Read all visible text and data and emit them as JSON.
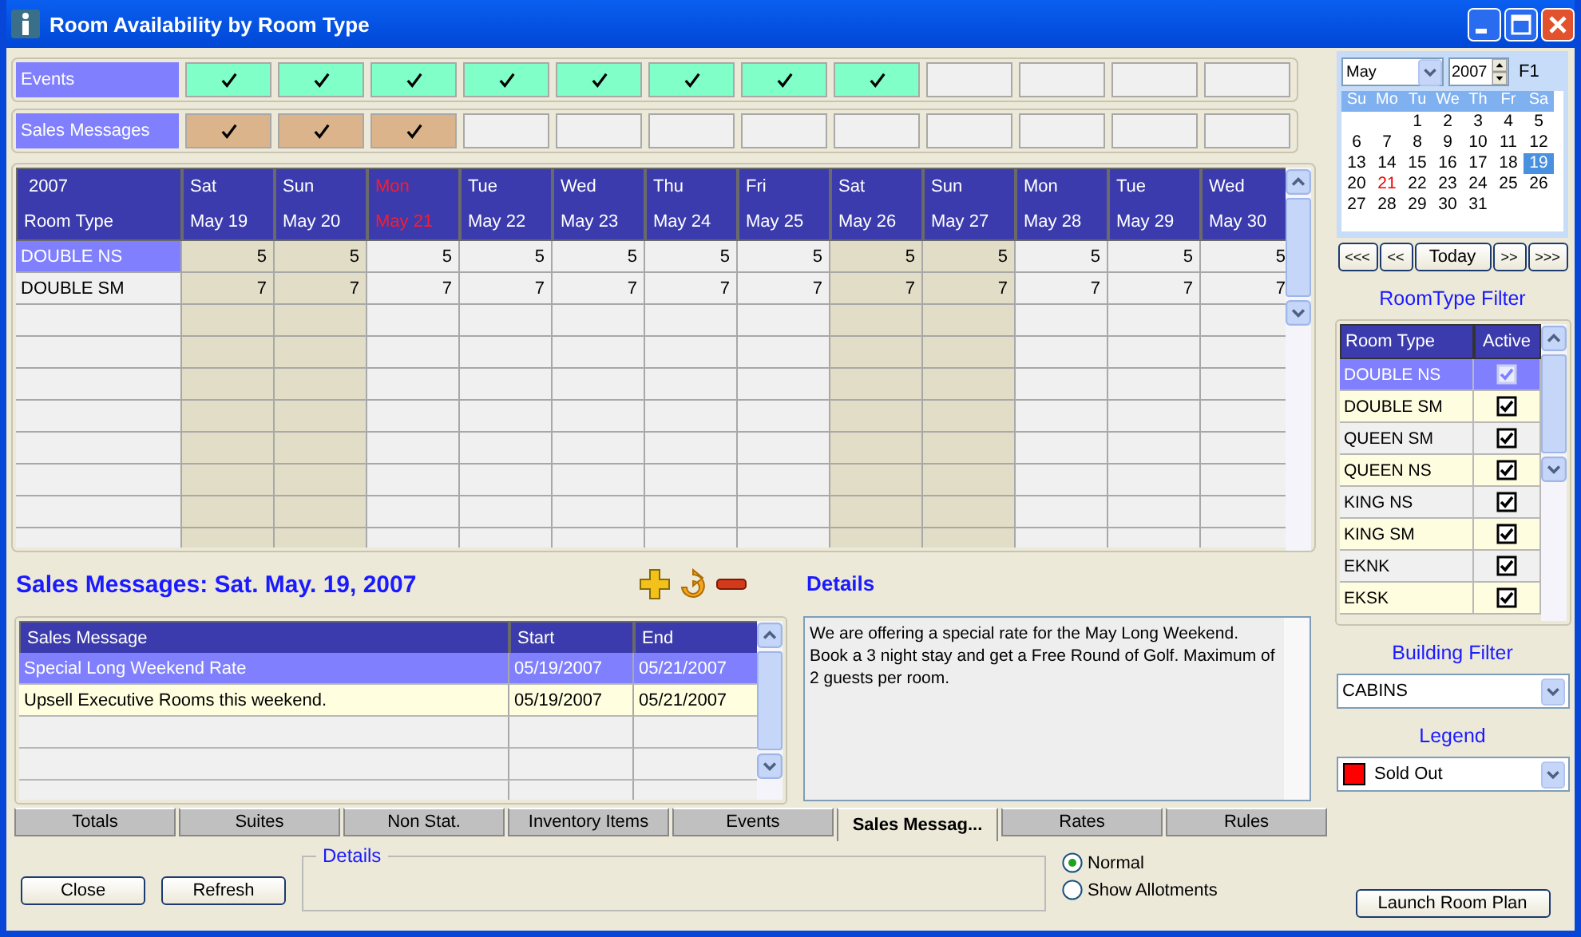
{
  "window": {
    "title": "Room Availability by Room Type"
  },
  "strips": [
    {
      "kind": "events",
      "label": "Events",
      "cells": [
        {
          "checked": true
        },
        {
          "checked": true
        },
        {
          "checked": true
        },
        {
          "checked": true
        },
        {
          "checked": true
        },
        {
          "checked": true
        },
        {
          "checked": true
        },
        {
          "checked": true
        },
        {
          "checked": false
        },
        {
          "checked": false
        },
        {
          "checked": false
        },
        {
          "checked": false
        }
      ]
    },
    {
      "kind": "sales",
      "label": "Sales Messages",
      "cells": [
        {
          "checked": true
        },
        {
          "checked": true
        },
        {
          "checked": true
        },
        {
          "checked": false
        },
        {
          "checked": false
        },
        {
          "checked": false
        },
        {
          "checked": false
        },
        {
          "checked": false
        },
        {
          "checked": false
        },
        {
          "checked": false
        },
        {
          "checked": false
        },
        {
          "checked": false
        }
      ]
    }
  ],
  "grid": {
    "year": "2007",
    "header": "Room Type",
    "days": [
      {
        "weekday": "Sat",
        "date": "May 19",
        "weekend": true,
        "holiday": false
      },
      {
        "weekday": "Sun",
        "date": "May 20",
        "weekend": true,
        "holiday": false
      },
      {
        "weekday": "Mon",
        "date": "May 21",
        "weekend": false,
        "holiday": true
      },
      {
        "weekday": "Tue",
        "date": "May 22",
        "weekend": false,
        "holiday": false
      },
      {
        "weekday": "Wed",
        "date": "May 23",
        "weekend": false,
        "holiday": false
      },
      {
        "weekday": "Thu",
        "date": "May 24",
        "weekend": false,
        "holiday": false
      },
      {
        "weekday": "Fri",
        "date": "May 25",
        "weekend": false,
        "holiday": false
      },
      {
        "weekday": "Sat",
        "date": "May 26",
        "weekend": true,
        "holiday": false
      },
      {
        "weekday": "Sun",
        "date": "May 27",
        "weekend": true,
        "holiday": false
      },
      {
        "weekday": "Mon",
        "date": "May 28",
        "weekend": false,
        "holiday": false
      },
      {
        "weekday": "Tue",
        "date": "May 29",
        "weekend": false,
        "holiday": false
      },
      {
        "weekday": "Wed",
        "date": "May 30",
        "weekend": false,
        "holiday": false
      }
    ],
    "rows": [
      {
        "name": "DOUBLE NS",
        "selected": true,
        "values": [
          "5",
          "5",
          "5",
          "5",
          "5",
          "5",
          "5",
          "5",
          "5",
          "5",
          "5",
          "5"
        ]
      },
      {
        "name": "DOUBLE SM",
        "selected": false,
        "values": [
          "7",
          "7",
          "7",
          "7",
          "7",
          "7",
          "7",
          "7",
          "7",
          "7",
          "7",
          "7"
        ]
      }
    ]
  },
  "sales_messages": {
    "title": "Sales Messages: Sat. May. 19, 2007",
    "columns": [
      "Sales Message",
      "Start",
      "End"
    ],
    "rows": [
      {
        "message": "Special Long Weekend Rate",
        "start": "05/19/2007",
        "end": "05/21/2007",
        "selected": true
      },
      {
        "message": "Upsell Executive Rooms this weekend.",
        "start": "05/19/2007",
        "end": "05/21/2007",
        "selected": false
      }
    ],
    "details_title": "Details",
    "details_text": "We are offering a special rate for the May Long Weekend. Book a 3 night stay and get a Free Round of Golf. Maximum of 2 guests per room."
  },
  "tabs": [
    {
      "label": "Totals",
      "selected": false
    },
    {
      "label": "Suites",
      "selected": false
    },
    {
      "label": "Non Stat.",
      "selected": false
    },
    {
      "label": "Inventory Items",
      "selected": false
    },
    {
      "label": "Events",
      "selected": false
    },
    {
      "label": "Sales Messag...",
      "selected": true
    },
    {
      "label": "Rates",
      "selected": false
    },
    {
      "label": "Rules",
      "selected": false
    }
  ],
  "buttons": [
    {
      "label": "Close"
    },
    {
      "label": "Refresh"
    }
  ],
  "details_group": {
    "legend": "Details"
  },
  "view_options": [
    {
      "label": "Normal",
      "selected": true
    },
    {
      "label": "Show Allotments",
      "selected": false
    }
  ],
  "calendar": {
    "month": "May",
    "year": "2007",
    "shortcut": "F1",
    "weekdays": [
      "Su",
      "Mo",
      "Tu",
      "We",
      "Th",
      "Fr",
      "Sa"
    ],
    "weeks": [
      {
        "days": [
          {
            "label": "1",
            "selected": false,
            "holiday": false
          },
          {
            "label": "2",
            "selected": false,
            "holiday": false
          },
          {
            "label": "3",
            "selected": false,
            "holiday": false
          },
          {
            "label": "4",
            "selected": false,
            "holiday": false
          },
          {
            "label": "5",
            "selected": false,
            "holiday": false
          }
        ]
      },
      {
        "days": [
          {
            "label": "6",
            "selected": false,
            "holiday": false
          },
          {
            "label": "7",
            "selected": false,
            "holiday": false
          },
          {
            "label": "8",
            "selected": false,
            "holiday": false
          },
          {
            "label": "9",
            "selected": false,
            "holiday": false
          },
          {
            "label": "10",
            "selected": false,
            "holiday": false
          },
          {
            "label": "11",
            "selected": false,
            "holiday": false
          },
          {
            "label": "12",
            "selected": false,
            "holiday": false
          }
        ]
      },
      {
        "days": [
          {
            "label": "13",
            "selected": false,
            "holiday": false
          },
          {
            "label": "14",
            "selected": false,
            "holiday": false
          },
          {
            "label": "15",
            "selected": false,
            "holiday": false
          },
          {
            "label": "16",
            "selected": false,
            "holiday": false
          },
          {
            "label": "17",
            "selected": false,
            "holiday": false
          },
          {
            "label": "18",
            "selected": false,
            "holiday": false
          },
          {
            "label": "19",
            "selected": true,
            "holiday": false
          }
        ]
      },
      {
        "days": [
          {
            "label": "20",
            "selected": false,
            "holiday": false
          },
          {
            "label": "21",
            "selected": false,
            "holiday": true
          },
          {
            "label": "22",
            "selected": false,
            "holiday": false
          },
          {
            "label": "23",
            "selected": false,
            "holiday": false
          },
          {
            "label": "24",
            "selected": false,
            "holiday": false
          },
          {
            "label": "25",
            "selected": false,
            "holiday": false
          },
          {
            "label": "26",
            "selected": false,
            "holiday": false
          }
        ]
      },
      {
        "days": [
          {
            "label": "27",
            "selected": false,
            "holiday": false
          },
          {
            "label": "28",
            "selected": false,
            "holiday": false
          },
          {
            "label": "29",
            "selected": false,
            "holiday": false
          },
          {
            "label": "30",
            "selected": false,
            "holiday": false
          },
          {
            "label": "31",
            "selected": false,
            "holiday": false
          }
        ]
      }
    ],
    "nav": [
      "<<<",
      "<<",
      "Today",
      ">>",
      ">>>"
    ]
  },
  "room_type_filter": {
    "title": "RoomType Filter",
    "columns": [
      "Room Type",
      "Active"
    ],
    "rows": [
      {
        "name": "DOUBLE NS",
        "active": true,
        "selected": true
      },
      {
        "name": "DOUBLE SM",
        "active": true,
        "selected": false
      },
      {
        "name": "QUEEN SM",
        "active": true,
        "selected": false
      },
      {
        "name": "QUEEN NS",
        "active": true,
        "selected": false
      },
      {
        "name": "KING NS",
        "active": true,
        "selected": false
      },
      {
        "name": "KING SM",
        "active": true,
        "selected": false
      },
      {
        "name": "EKNK",
        "active": true,
        "selected": false
      },
      {
        "name": "EKSK",
        "active": true,
        "selected": false
      }
    ]
  },
  "building_filter": {
    "title": "Building Filter",
    "value": "CABINS"
  },
  "legend": {
    "title": "Legend",
    "value": "Sold Out",
    "color": "#ff0000"
  },
  "launch_button": "Launch Room Plan"
}
